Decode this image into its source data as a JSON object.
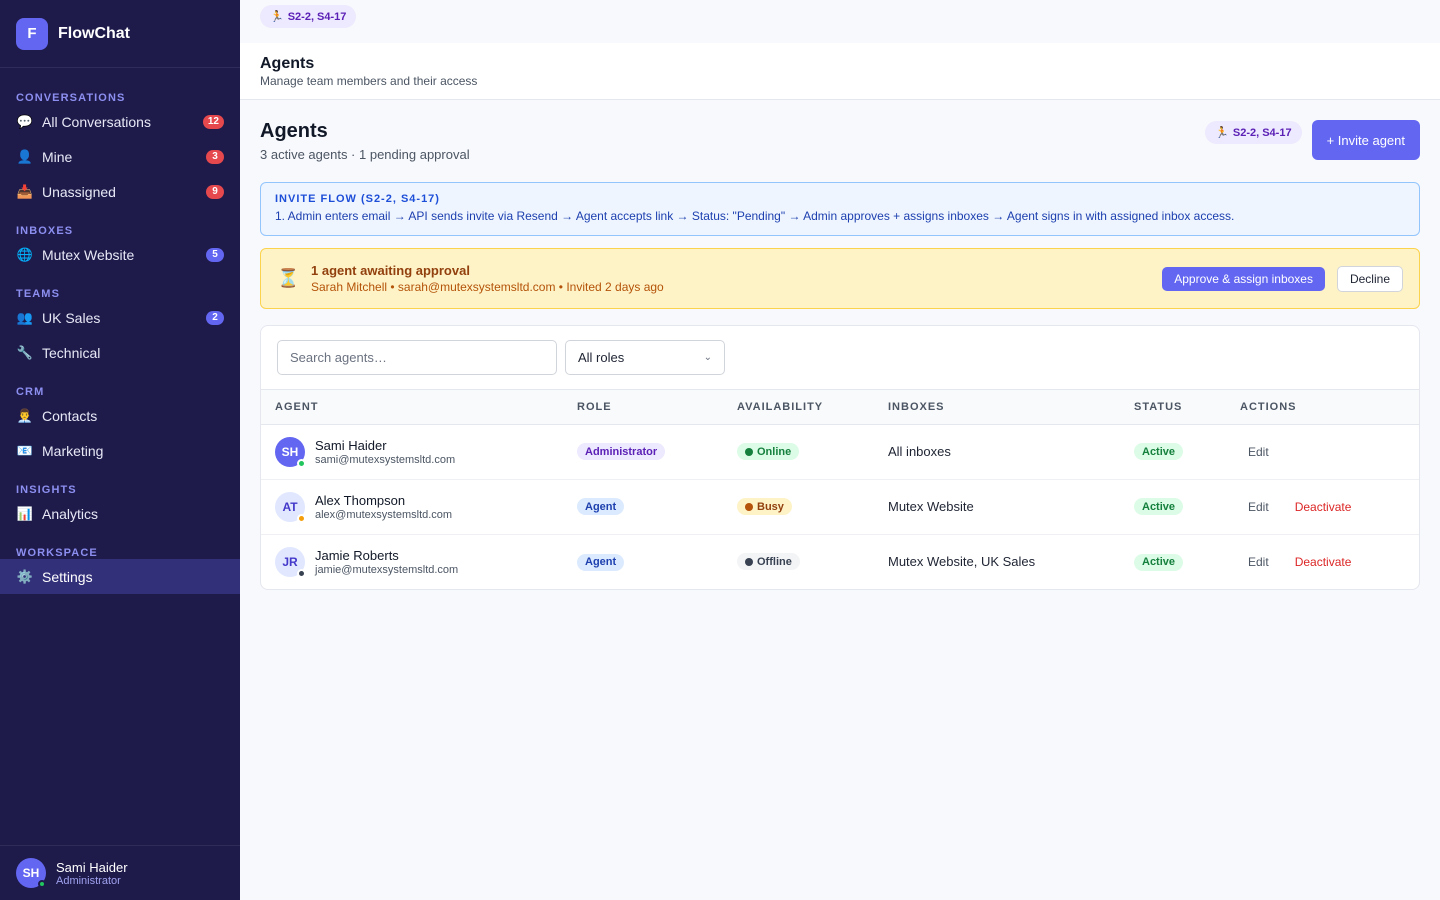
{
  "brand": {
    "logo": "F",
    "name": "FlowChat"
  },
  "sidebar": {
    "sections": [
      {
        "title": "CONVERSATIONS",
        "items": [
          {
            "icon": "💬",
            "label": "All Conversations",
            "badge": "12",
            "badge_color": "red"
          },
          {
            "icon": "👤",
            "label": "Mine",
            "badge": "3",
            "badge_color": "red"
          },
          {
            "icon": "📥",
            "label": "Unassigned",
            "badge": "9",
            "badge_color": "red"
          }
        ]
      },
      {
        "title": "INBOXES",
        "items": [
          {
            "icon": "🌐",
            "label": "Mutex Website",
            "badge": "5",
            "badge_color": "blue"
          }
        ]
      },
      {
        "title": "TEAMS",
        "items": [
          {
            "icon": "👥",
            "label": "UK Sales",
            "badge": "2",
            "badge_color": "blue"
          },
          {
            "icon": "🔧",
            "label": "Technical",
            "badge": "",
            "badge_color": ""
          }
        ]
      },
      {
        "title": "CRM",
        "items": [
          {
            "icon": "👨‍💼",
            "label": "Contacts",
            "badge": "",
            "badge_color": ""
          },
          {
            "icon": "📧",
            "label": "Marketing",
            "badge": "",
            "badge_color": ""
          }
        ]
      },
      {
        "title": "INSIGHTS",
        "items": [
          {
            "icon": "📊",
            "label": "Analytics",
            "badge": "",
            "badge_color": ""
          }
        ]
      },
      {
        "title": "WORKSPACE",
        "items": [
          {
            "icon": "⚙️",
            "label": "Settings",
            "badge": "",
            "badge_color": "",
            "active": true
          }
        ]
      }
    ],
    "user": {
      "initials": "SH",
      "name": "Sami Haider",
      "role": "Administrator"
    }
  },
  "topstrip": {
    "pill": "S2-2, S4-17",
    "pill_icon": "🏃"
  },
  "page_header": {
    "title": "Agents",
    "subtitle": "Manage team members and their access"
  },
  "content": {
    "title": "Agents",
    "subtitle": "3 active agents · 1 pending approval",
    "pill": "S2-2, S4-17",
    "invite_button": "+ Invite agent"
  },
  "infobox": {
    "title": "INVITE FLOW (S2-2, S4-17)",
    "text": "1. Admin enters email → API sends invite via Resend → Agent accepts link → Status: \"Pending\" → Admin approves + assigns inboxes → Agent signs in with assigned inbox access."
  },
  "approval": {
    "title": "1 agent awaiting approval",
    "subtitle": "Sarah Mitchell • sarah@mutexsystemsltd.com • Invited 2 days ago",
    "approve_button": "Approve & assign inboxes",
    "decline_button": "Decline"
  },
  "filters": {
    "search_placeholder": "Search agents…",
    "role_select": "All roles"
  },
  "table": {
    "columns": [
      "AGENT",
      "ROLE",
      "AVAILABILITY",
      "INBOXES",
      "STATUS",
      "ACTIONS"
    ],
    "rows": [
      {
        "initials": "SH",
        "avatar_style": "primary",
        "presence_color": "#22c55e",
        "name": "Sami Haider",
        "email": "sami@mutexsystemsltd.com",
        "role": "Administrator",
        "role_style": "admin",
        "availability": "Online",
        "avail_bg": "#dcfce7",
        "avail_color": "#15803d",
        "avail_dot": "#15803d",
        "inboxes": "All inboxes",
        "status": "Active",
        "edit": "Edit",
        "deactivate": ""
      },
      {
        "initials": "AT",
        "avatar_style": "light",
        "presence_color": "#f59e0b",
        "name": "Alex Thompson",
        "email": "alex@mutexsystemsltd.com",
        "role": "Agent",
        "role_style": "agent",
        "availability": "Busy",
        "avail_bg": "#fef3c7",
        "avail_color": "#92400e",
        "avail_dot": "#b45309",
        "inboxes": "Mutex Website",
        "status": "Active",
        "edit": "Edit",
        "deactivate": "Deactivate"
      },
      {
        "initials": "JR",
        "avatar_style": "light",
        "presence_color": "#374151",
        "name": "Jamie Roberts",
        "email": "jamie@mutexsystemsltd.com",
        "role": "Agent",
        "role_style": "agent",
        "availability": "Offline",
        "avail_bg": "#f3f4f6",
        "avail_color": "#374151",
        "avail_dot": "#374151",
        "inboxes": "Mutex Website, UK Sales",
        "status": "Active",
        "edit": "Edit",
        "deactivate": "Deactivate"
      }
    ]
  }
}
